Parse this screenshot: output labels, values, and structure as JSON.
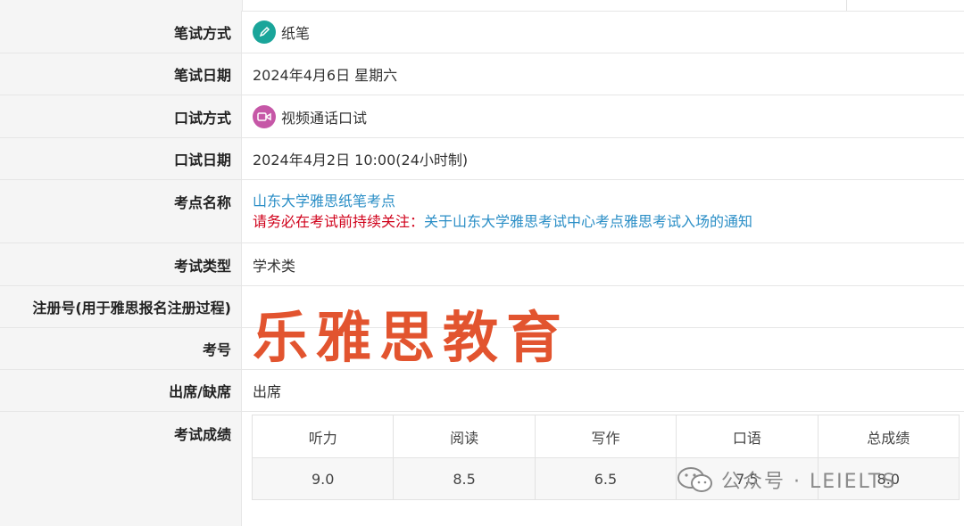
{
  "rows": [
    {
      "label": "笔试方式",
      "value": "纸笔",
      "icon": "pencil-icon"
    },
    {
      "label": "笔试日期",
      "value": "2024年4月6日 星期六"
    },
    {
      "label": "口试方式",
      "value": "视频通话口试",
      "icon": "video-camera-icon"
    },
    {
      "label": "口试日期",
      "value": "2024年4月2日 10:00(24小时制)"
    },
    {
      "label": "考点名称",
      "value": "山东大学雅思纸笔考点",
      "warn_prefix": "请务必在考试前持续关注：",
      "notice_link": "关于山东大学雅思考试中心考点雅思考试入场的通知"
    },
    {
      "label": "考试类型",
      "value": "学术类"
    },
    {
      "label": "注册号(用于雅思报名注册过程)",
      "value": ""
    },
    {
      "label": "考号",
      "value": ""
    },
    {
      "label": "出席/缺席",
      "value": "出席"
    },
    {
      "label": "考试成绩"
    }
  ],
  "scores": {
    "headers": [
      "听力",
      "阅读",
      "写作",
      "口语",
      "总成绩"
    ],
    "values": [
      "9.0",
      "8.5",
      "6.5",
      "7.5",
      "8.0"
    ]
  },
  "watermark": "乐雅思教育",
  "wechat_mark": "公众号 · LEIELTS",
  "colors": {
    "teal": "#1aa59a",
    "pink": "#c657a7",
    "link": "#2a8ec6",
    "warn": "#d0021b",
    "watermark": "#e2542f"
  }
}
